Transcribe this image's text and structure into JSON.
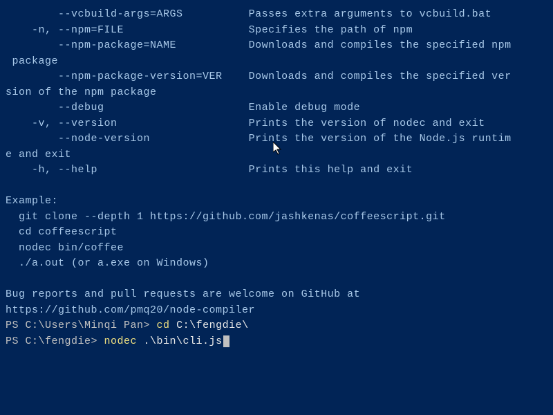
{
  "options": [
    {
      "flags": "        --vcbuild-args=ARGS",
      "desc": "Passes extra arguments to vcbuild.bat"
    },
    {
      "flags": "    -n, --npm=FILE",
      "desc": "Specifies the path of npm"
    },
    {
      "flags": "        --npm-package=NAME",
      "desc": "Downloads and compiles the specified npm",
      "cont": " package"
    },
    {
      "flags": "        --npm-package-version=VER",
      "desc": "Downloads and compiles the specified ver",
      "cont": "sion of the npm package"
    },
    {
      "flags": "        --debug",
      "desc": "Enable debug mode"
    },
    {
      "flags": "    -v, --version",
      "desc": "Prints the version of nodec and exit"
    },
    {
      "flags": "        --node-version",
      "desc": "Prints the version of the Node.js runtim",
      "cont": "e and exit"
    },
    {
      "flags": "    -h, --help",
      "desc": "Prints this help and exit"
    }
  ],
  "example": {
    "heading": "Example:",
    "lines": [
      "  git clone --depth 1 https://github.com/jashkenas/coffeescript.git",
      "  cd coffeescript",
      "  nodec bin/coffee",
      "  ./a.out (or a.exe on Windows)"
    ]
  },
  "footer": {
    "line1": "Bug reports and pull requests are welcome on GitHub at",
    "line2": "https://github.com/pmq20/node-compiler"
  },
  "prompts": [
    {
      "ps": "PS C:\\Users\\Minqi Pan> ",
      "cmd_y": "cd ",
      "cmd_w": "C:\\fengdie\\"
    },
    {
      "ps": "PS C:\\fengdie> ",
      "cmd_y": "nodec ",
      "cmd_w": ".\\bin\\cli.js"
    }
  ],
  "cursor_icon": "arrow-pointer"
}
